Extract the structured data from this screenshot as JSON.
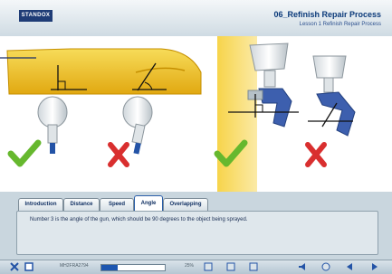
{
  "header": {
    "logo": "STANDOX",
    "title": "06_Refinish Repair Process",
    "subtitle": "Lesson 1   Refinish Repair Process"
  },
  "tabs": [
    {
      "label": "Introduction"
    },
    {
      "label": "Distance"
    },
    {
      "label": "Speed"
    },
    {
      "label": "Angle",
      "active": true
    },
    {
      "label": "Overlapping"
    }
  ],
  "content": {
    "caption": "Number 3 is the angle of the gun, which should be 90 degrees to the object being sprayed."
  },
  "status": {
    "code": "MH2FRA2794",
    "progress_label": "25%",
    "progress": 0.25
  },
  "colors": {
    "accent": "#1c56b0",
    "correct": "#66b82e",
    "incorrect": "#d92f2f",
    "panel_yellow": "#f1c234"
  }
}
